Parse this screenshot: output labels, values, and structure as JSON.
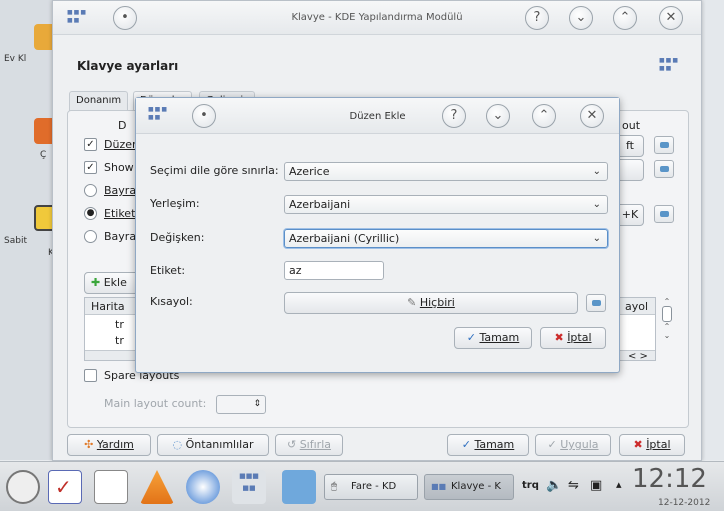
{
  "desktop": {
    "icons": [
      {
        "label": "Ev Kl",
        "icon": "folder-icon"
      },
      {
        "label": "Ç",
        "icon": "trash-icon"
      },
      {
        "label": "Sabit",
        "icon": "disk-icon"
      },
      {
        "label": "K",
        "icon": "disk-label"
      }
    ]
  },
  "main_window": {
    "title": "Klavye - KDE Yapılandırma Modülü",
    "heading": "Klavye ayarları",
    "tabs": [
      "Donanım",
      "Düzenler",
      "Gelişmiş"
    ],
    "options": [
      {
        "label": "Düzen",
        "type": "checkbox",
        "checked": true
      },
      {
        "label": "Show",
        "type": "checkbox",
        "checked": true
      },
      {
        "label": "Bayra",
        "type": "radio",
        "checked": false
      },
      {
        "label": "Etiket",
        "type": "radio",
        "checked": true
      },
      {
        "label": "Bayra",
        "type": "radio",
        "checked": false
      }
    ],
    "right_buttons": [
      "ft",
      "+K"
    ],
    "column_out": "out",
    "add_button": "Ekle",
    "table": {
      "headers": [
        "Harita",
        "ayol"
      ],
      "rows": [
        [
          "tr"
        ],
        [
          "tr"
        ]
      ]
    },
    "spare_layouts": "Spare layouts",
    "main_layout_count": "Main layout count:",
    "bottom_buttons": {
      "help": "Yardım",
      "defaults": "Öntanımlılar",
      "reset": "Sıfırla",
      "ok": "Tamam",
      "apply": "Uygula",
      "cancel": "İptal"
    },
    "colors": {
      "accent": "#4a7fbf",
      "ok": "#2f6fc0",
      "cancel": "#cc2b2b"
    }
  },
  "dialog": {
    "title": "Düzen Ekle",
    "fields": {
      "limit_label": "Seçimi dile göre sınırla:",
      "limit_value": "Azerice",
      "layout_label": "Yerleşim:",
      "layout_value": "Azerbaijani",
      "variant_label": "Değişken:",
      "variant_value": "Azerbaijani (Cyrillic)",
      "tag_label": "Etiket:",
      "tag_value": "az",
      "shortcut_label": "Kısayol:",
      "shortcut_value": "Hiçbiri"
    },
    "buttons": {
      "ok": "Tamam",
      "cancel": "İptal"
    }
  },
  "taskbar": {
    "tasks": [
      {
        "label": "Fare - KD"
      },
      {
        "label": "Klavye - K"
      }
    ],
    "keyboard_layout": "trq",
    "clock_time": "12:12",
    "clock_date": "12-12-2012"
  }
}
